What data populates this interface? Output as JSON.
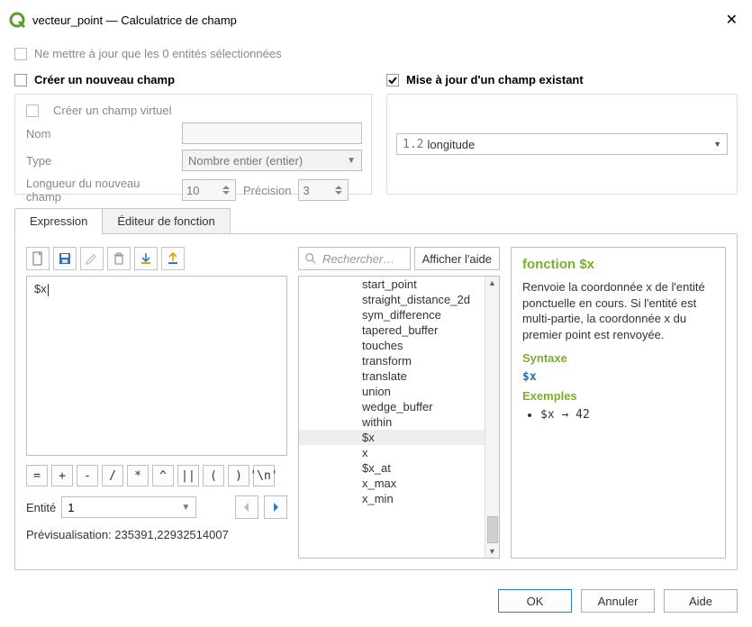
{
  "window": {
    "title": "vecteur_point — Calculatrice de champ"
  },
  "top": {
    "only_selected": "Ne mettre à jour que les 0 entités sélectionnées"
  },
  "create": {
    "heading": "Créer un nouveau champ",
    "virtual": "Créer un champ virtuel",
    "name_label": "Nom",
    "name_value": "",
    "type_label": "Type",
    "type_value": "Nombre entier (entier)",
    "length_label": "Longueur du nouveau champ",
    "length_value": "10",
    "precision_label": "Précision",
    "precision_value": "3"
  },
  "update": {
    "heading": "Mise à jour d'un champ existant",
    "field_prefix": "1.2",
    "field_name": "longitude"
  },
  "tabs": {
    "expression": "Expression",
    "function_editor": "Éditeur de fonction"
  },
  "expression": {
    "text": "$x"
  },
  "operators": [
    "=",
    "+",
    "-",
    "/",
    "*",
    "^",
    "||",
    "(",
    ")",
    "'\\n'"
  ],
  "entity": {
    "label": "Entité",
    "value": "1"
  },
  "preview": {
    "label": "Prévisualisation:",
    "value": "235391,22932514007"
  },
  "search": {
    "placeholder": "Rechercher…",
    "show_help": "Afficher l'aide"
  },
  "functions": [
    "start_point",
    "straight_distance_2d",
    "sym_difference",
    "tapered_buffer",
    "touches",
    "transform",
    "translate",
    "union",
    "wedge_buffer",
    "within",
    "$x",
    "x",
    "$x_at",
    "x_max",
    "x_min"
  ],
  "functions_selected": "$x",
  "help": {
    "title": "fonction $x",
    "description": "Renvoie la coordonnée x de l'entité ponctuelle en cours. Si l'entité est multi-partie, la coordonnée x du premier point est renvoyée.",
    "syntax_heading": "Syntaxe",
    "syntax_token": "$x",
    "examples_heading": "Exemples",
    "example_1": "$x → 42"
  },
  "footer": {
    "ok": "OK",
    "cancel": "Annuler",
    "help": "Aide"
  }
}
